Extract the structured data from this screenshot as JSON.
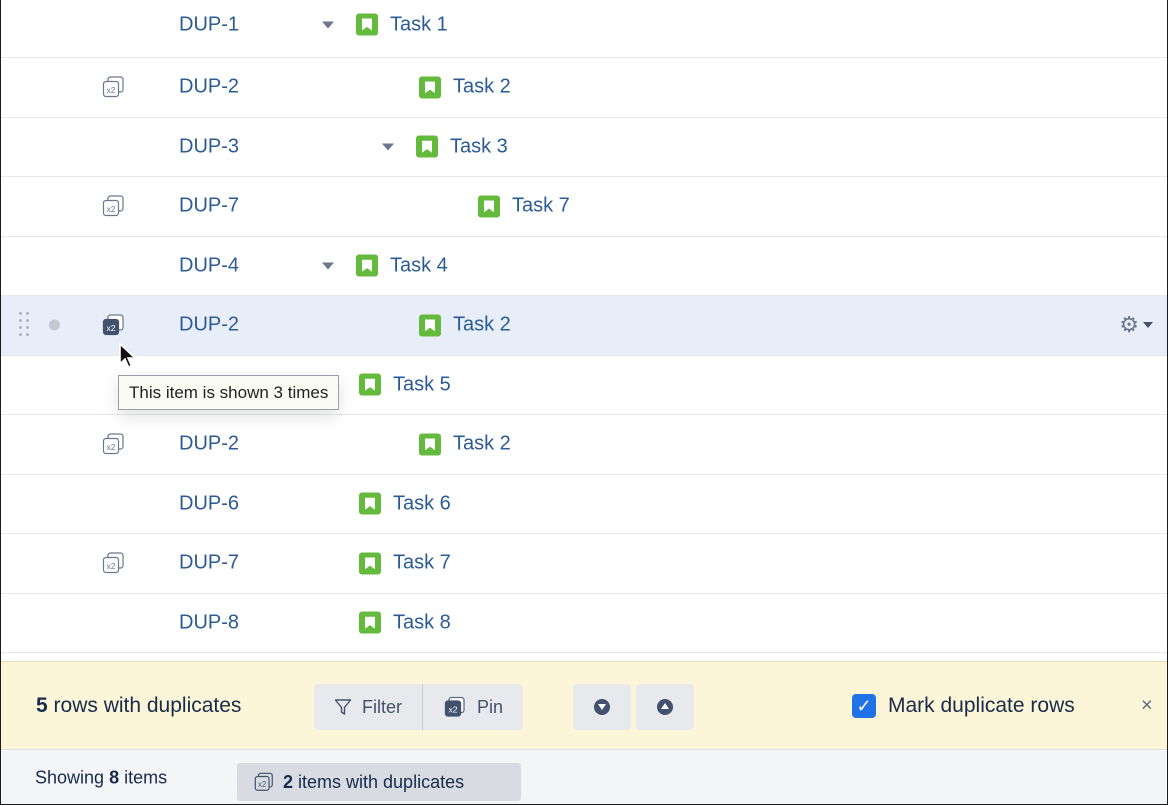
{
  "rows": [
    {
      "key": "DUP-1",
      "summary": "Task 1",
      "level": 0,
      "expandable": true,
      "duplicate": false
    },
    {
      "key": "DUP-2",
      "summary": "Task 2",
      "level": 1,
      "expandable": false,
      "duplicate": true
    },
    {
      "key": "DUP-3",
      "summary": "Task 3",
      "level": 1,
      "expandable": true,
      "duplicate": false
    },
    {
      "key": "DUP-7",
      "summary": "Task 7",
      "level": 2,
      "expandable": false,
      "duplicate": true
    },
    {
      "key": "DUP-4",
      "summary": "Task 4",
      "level": 0,
      "expandable": true,
      "duplicate": false
    },
    {
      "key": "DUP-2",
      "summary": "Task 2",
      "level": 1,
      "expandable": false,
      "duplicate": true,
      "selected": true
    },
    {
      "key": "",
      "summary": "Task 5",
      "level": 0,
      "expandable": false,
      "duplicate": false
    },
    {
      "key": "DUP-2",
      "summary": "Task 2",
      "level": 1,
      "expandable": false,
      "duplicate": true
    },
    {
      "key": "DUP-6",
      "summary": "Task 6",
      "level": 0,
      "expandable": false,
      "duplicate": false
    },
    {
      "key": "DUP-7",
      "summary": "Task 7",
      "level": 0,
      "expandable": false,
      "duplicate": true
    },
    {
      "key": "DUP-8",
      "summary": "Task 8",
      "level": 0,
      "expandable": false,
      "duplicate": false
    }
  ],
  "tooltip": "This item is shown 3 times",
  "duplicates_bar": {
    "count": "5",
    "count_suffix": " rows with duplicates",
    "filter_label": "Filter",
    "pin_label": "Pin",
    "mark_label": "Mark duplicate rows",
    "mark_checked": true,
    "close_label": "×"
  },
  "status": {
    "showing_prefix": "Showing ",
    "showing_count": "8",
    "showing_suffix": " items",
    "dup_count": "2",
    "dup_suffix": " items with duplicates"
  },
  "colors": {
    "link": "#2b5b95",
    "story_icon": "#63ba3c",
    "selected_row": "#e8eef9",
    "notice_bg": "#fdf5d7",
    "checkbox": "#1f73e6"
  },
  "icons": {
    "duplicate": "duplicate-x2-icon",
    "story": "story-icon",
    "expand": "caret-down-icon",
    "gear": "gear-icon",
    "filter": "filter-icon",
    "move_down": "arrow-down-circle-icon",
    "move_up": "arrow-up-circle-icon"
  }
}
